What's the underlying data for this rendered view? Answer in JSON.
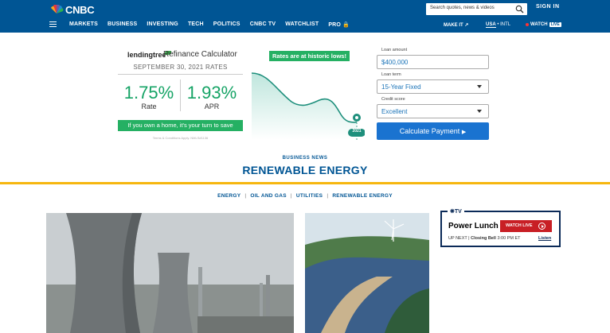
{
  "header": {
    "logo_text": "CNBC",
    "search_placeholder": "Search quotes, news & videos",
    "signin_label": "SIGN IN",
    "nav": [
      "MARKETS",
      "BUSINESS",
      "INVESTING",
      "TECH",
      "POLITICS",
      "CNBC TV",
      "WATCHLIST",
      "PRO"
    ],
    "make_it": "MAKE IT",
    "region_usa": "USA",
    "region_sep": "•",
    "region_intl": "INTL",
    "watch_label": "WATCH",
    "live_label": "LIVE"
  },
  "ad": {
    "brand": "lendingtree",
    "title": "Refinance Calculator",
    "date": "SEPTEMBER 30, 2021 RATES",
    "rate_value": "1.75%",
    "rate_label": "Rate",
    "apr_value": "1.93%",
    "apr_label": "APR",
    "cta": "If you own a home, it's your turn to save",
    "terms": "Terms & Conditions Apply. NMLS#1136",
    "badge": "Rates are at historic lows!",
    "chart_year": "2021",
    "loan_amount_label": "Loan amount",
    "loan_amount_value": "$400,000",
    "loan_term_label": "Loan term",
    "loan_term_value": "15-Year Fixed",
    "credit_label": "Credit score",
    "credit_value": "Excellent",
    "calc_button": "Calculate Payment"
  },
  "section": {
    "kicker": "BUSINESS NEWS",
    "title": "RENEWABLE ENERGY",
    "subnav": [
      "ENERGY",
      "OIL AND GAS",
      "UTILITIES",
      "RENEWABLE ENERGY"
    ]
  },
  "tv": {
    "logo": "TV",
    "show": "Power Lunch",
    "watch_live": "WATCH LIVE",
    "up_next_prefix": "UP NEXT |",
    "up_next_show": "Closing Bell",
    "up_next_time": "3:00 PM ET",
    "listen": "Listen"
  }
}
